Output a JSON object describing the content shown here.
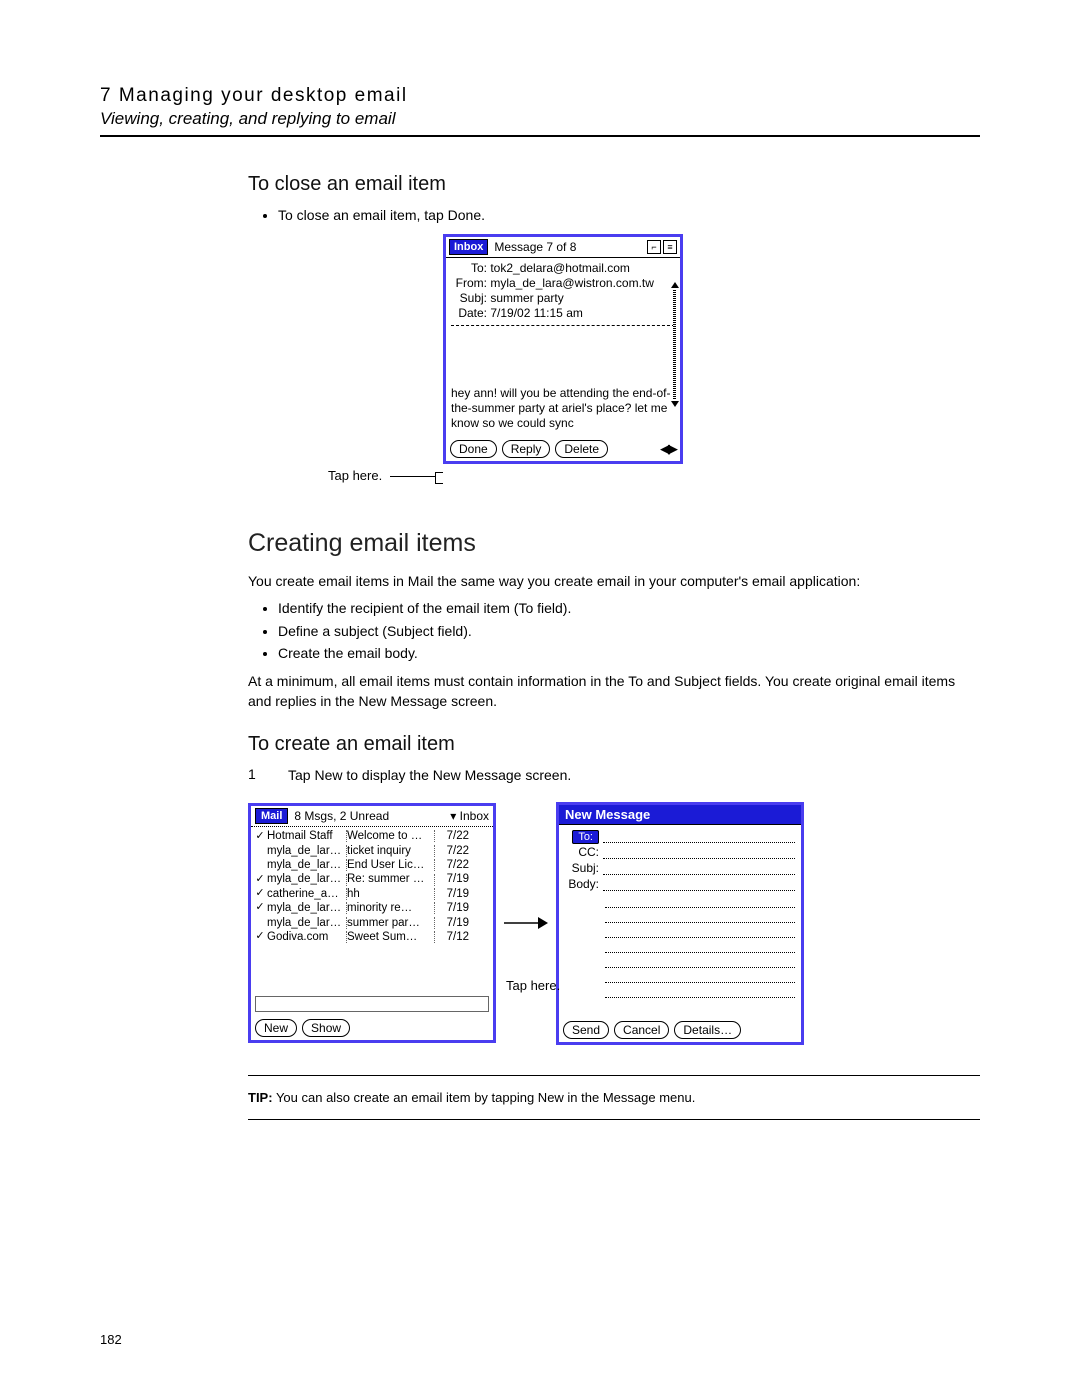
{
  "header": {
    "chapter_num": "7",
    "chapter_title": "Managing your desktop email",
    "chapter_sub": "Viewing, creating, and replying to email"
  },
  "sec_close": {
    "heading": "To close an email item",
    "bullet": "To close an email item, tap Done.",
    "callout": "Tap here."
  },
  "inbox_pane": {
    "box_label": "Inbox",
    "counter": "Message 7 of 8",
    "to_label": "To:",
    "to_val": "tok2_delara@hotmail.com",
    "from_label": "From:",
    "from_val": "myla_de_lara@wistron.com.tw",
    "subj_label": "Subj:",
    "subj_val": "summer party",
    "date_label": "Date:",
    "date_val": "7/19/02 11:15 am",
    "body": "hey ann! will you be attending the end-of-the-summer party at ariel's place? let me know so we could sync",
    "btn_done": "Done",
    "btn_reply": "Reply",
    "btn_delete": "Delete"
  },
  "sec_create": {
    "heading": "Creating email items",
    "intro": "You create email items in Mail the same way you create email in your computer's email application:",
    "b1": "Identify the recipient of the email item (To field).",
    "b2": "Define a subject (Subject field).",
    "b3": "Create the email body.",
    "after": "At a minimum, all email items must contain information in the To and Subject fields. You create original email items and replies in the New Message screen."
  },
  "sec_to_create": {
    "heading": "To create an email item",
    "step_num": "1",
    "step_text": "Tap New to display the New Message screen.",
    "callout": "Tap here."
  },
  "mail_pane": {
    "badge": "Mail",
    "status": "8 Msgs, 2 Unread",
    "folder": "Inbox",
    "btn_new": "New",
    "btn_show": "Show",
    "rows": [
      {
        "chk": "✓",
        "from": "Hotmail Staff",
        "subj": "Welcome to …",
        "date": "7/22"
      },
      {
        "chk": "",
        "from": "myla_de_lar…",
        "subj": "ticket inquiry",
        "date": "7/22"
      },
      {
        "chk": "",
        "from": "myla_de_lar…",
        "subj": "End User Lic…",
        "date": "7/22"
      },
      {
        "chk": "✓",
        "from": "myla_de_lar…",
        "subj": "Re: summer …",
        "date": "7/19"
      },
      {
        "chk": "✓",
        "from": "catherine_a…",
        "subj": "hh",
        "date": "7/19"
      },
      {
        "chk": "✓",
        "from": "myla_de_lar…",
        "subj": "minority re…",
        "date": "7/19"
      },
      {
        "chk": "",
        "from": "myla_de_lar…",
        "subj": "summer par…",
        "date": "7/19"
      },
      {
        "chk": "✓",
        "from": "Godiva.com",
        "subj": "Sweet Sum…",
        "date": "7/12"
      }
    ]
  },
  "newmsg_pane": {
    "title": "New Message",
    "to": "To:",
    "cc": "CC:",
    "subj": "Subj:",
    "body": "Body:",
    "btn_send": "Send",
    "btn_cancel": "Cancel",
    "btn_details": "Details…"
  },
  "tip": {
    "label": "TIP:",
    "text": "You can also create an email item by tapping New in the Message menu."
  },
  "page_number": "182"
}
